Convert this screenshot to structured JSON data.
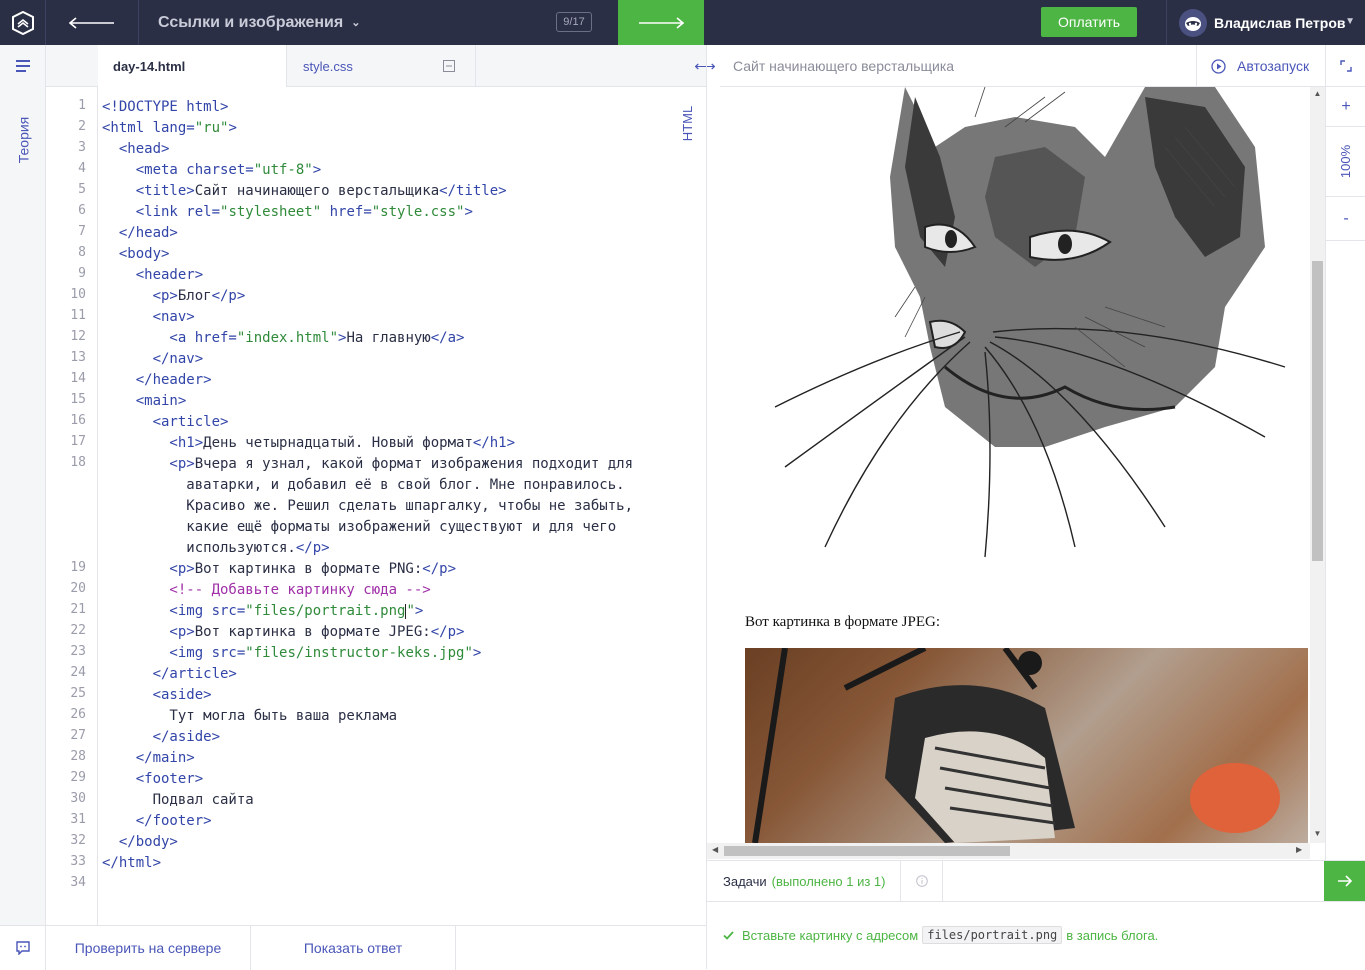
{
  "topbar": {
    "lesson_title": "Ссылки и изображения",
    "counter": "9/17",
    "pay_label": "Оплатить",
    "user_name": "Владислав Петров"
  },
  "sidebar": {
    "theory_label": "Теория"
  },
  "editor": {
    "tabs": [
      {
        "label": "day-14.html"
      },
      {
        "label": "style.css"
      }
    ],
    "mode_label": "HTML",
    "line_numbers": [
      "1",
      "2",
      "3",
      "4",
      "5",
      "6",
      "7",
      "8",
      "9",
      "10",
      "11",
      "12",
      "13",
      "14",
      "15",
      "16",
      "17",
      "18",
      "19",
      "20",
      "21",
      "22",
      "23",
      "24",
      "25",
      "26",
      "27",
      "28",
      "29",
      "30",
      "31",
      "32",
      "33",
      "34"
    ],
    "lines": {
      "l1": "<!DOCTYPE html>",
      "l2a": "<html lang=",
      "l2b": "\"ru\"",
      "l2c": ">",
      "l3": "  <head>",
      "l4a": "    <meta charset=",
      "l4b": "\"utf-8\"",
      "l4c": ">",
      "l5a": "    <title>",
      "l5b": "Сайт начинающего верстальщика",
      "l5c": "</title>",
      "l6a": "    <link rel=",
      "l6b": "\"stylesheet\"",
      "l6c": " href=",
      "l6d": "\"style.css\"",
      "l6e": ">",
      "l7": "  </head>",
      "l8": "  <body>",
      "l9": "    <header>",
      "l10a": "      <p>",
      "l10b": "Блог",
      "l10c": "</p>",
      "l11": "      <nav>",
      "l12a": "        <a href=",
      "l12b": "\"index.html\"",
      "l12c": ">",
      "l12d": "На главную",
      "l12e": "</a>",
      "l13": "      </nav>",
      "l14": "    </header>",
      "l15": "    <main>",
      "l16": "      <article>",
      "l17a": "        <h1>",
      "l17b": "День четырнадцатый. Новый формат",
      "l17c": "</h1>",
      "l18a": "        <p>",
      "l18b": "Вчера я узнал, какой формат изображения подходит для",
      "l18w1": "          аватарки, и добавил её в свой блог. Мне понравилось.",
      "l18w2": "          Красиво же. Решил сделать шпаргалку, чтобы не забыть,",
      "l18w3": "          какие ещё форматы изображений существуют и для чего",
      "l18w4a": "          используются.",
      "l18w4b": "</p>",
      "l19a": "        <p>",
      "l19b": "Вот картинка в формате PNG:",
      "l19c": "</p>",
      "l20": "        <!-- Добавьте картинку сюда -->",
      "l21a": "        <img src=",
      "l21b": "\"files/portrait.png",
      "l21c": "\"",
      "l21d": ">",
      "l22a": "        <p>",
      "l22b": "Вот картинка в формате JPEG:",
      "l22c": "</p>",
      "l23a": "        <img src=",
      "l23b": "\"files/instructor-keks.jpg\"",
      "l23c": ">",
      "l24": "      </article>",
      "l25": "      <aside>",
      "l26": "        Тут могла быть ваша реклама",
      "l27": "      </aside>",
      "l28": "    </main>",
      "l29": "    <footer>",
      "l30": "      Подвал сайта",
      "l31": "    </footer>",
      "l32": "  </body>",
      "l33": "</html>"
    }
  },
  "bottom": {
    "check_label": "Проверить на сервере",
    "answer_label": "Показать ответ"
  },
  "preview": {
    "title": "Сайт начинающего верстальщика",
    "autorun_label": "Автозапуск",
    "zoom": "100%",
    "jpeg_caption": "Вот картинка в формате JPEG:"
  },
  "tasks": {
    "label": "Задачи",
    "progress": "(выполнено 1 из 1)",
    "task_prefix": "Вставьте картинку с адресом",
    "task_code": "files/portrait.png",
    "task_suffix": "в запись блога."
  },
  "colors": {
    "accent": "#4a56b8",
    "green": "#4cb543",
    "topbar": "#2b2f45"
  }
}
